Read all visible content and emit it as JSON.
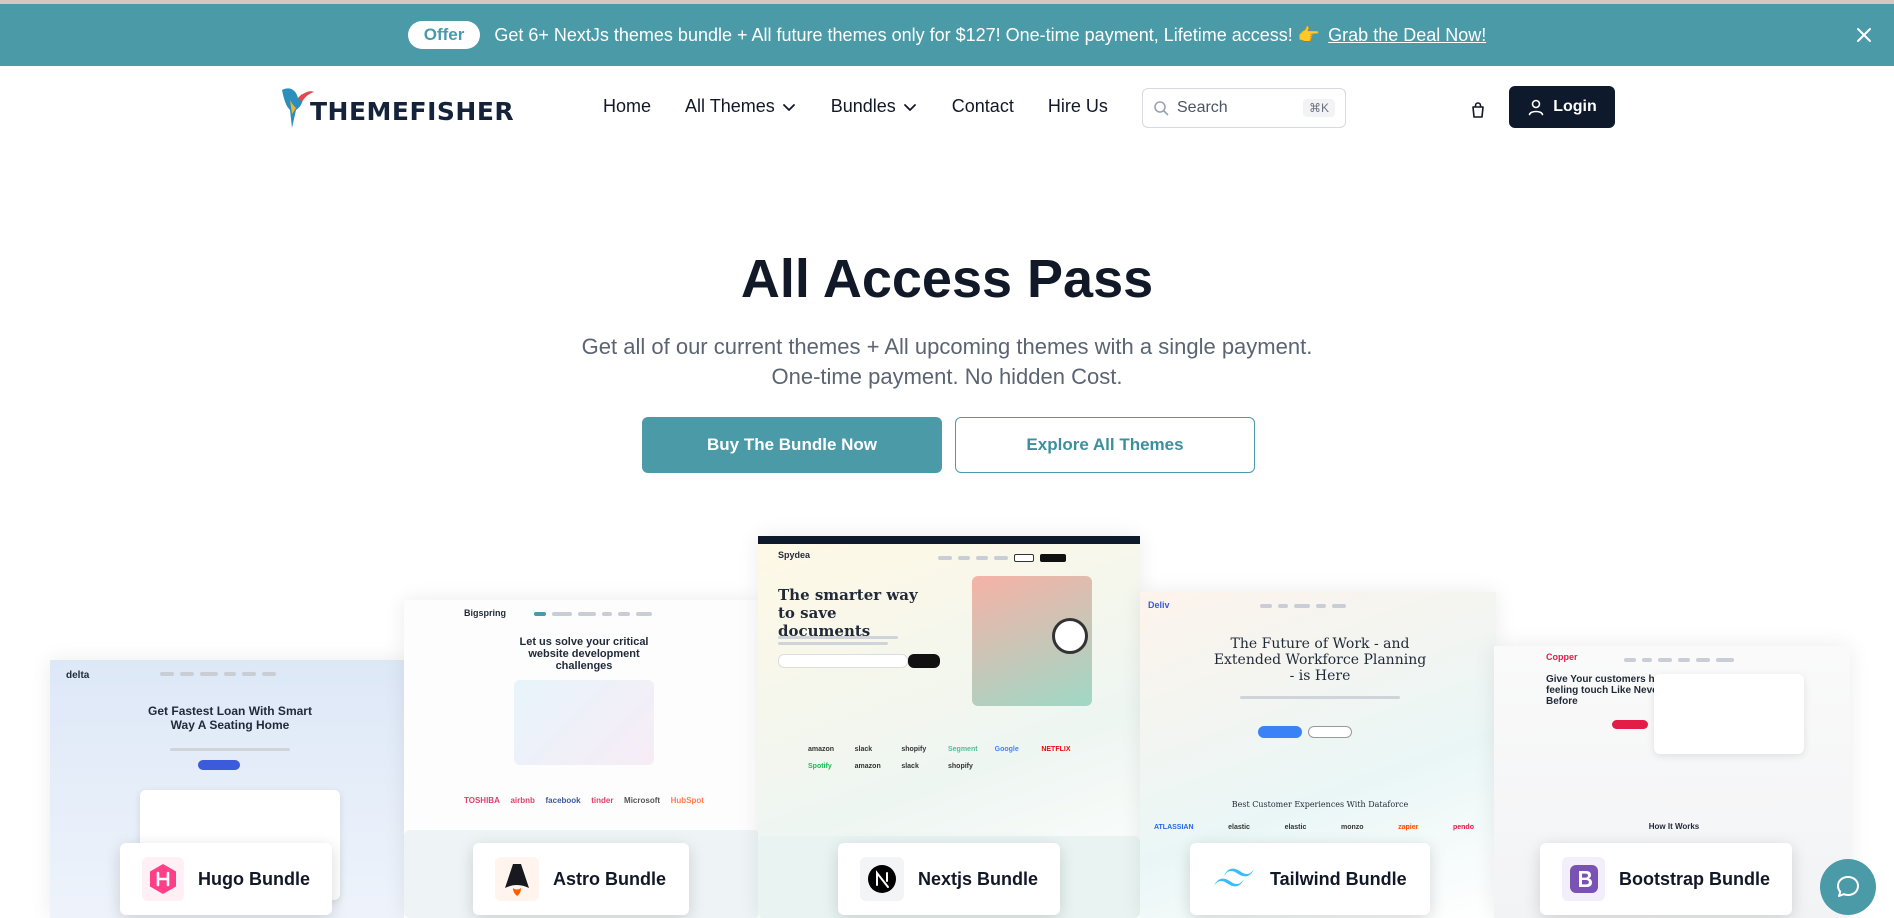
{
  "colors": {
    "accent": "#4a9aa8",
    "dark": "#0e1a2b"
  },
  "offer": {
    "pill": "Offer",
    "text": "Get 6+ NextJs themes bundle + All future themes only for $127! One-time payment, Lifetime access! 👉",
    "link": "Grab the Deal Now!"
  },
  "brand": {
    "name": "THEMEFISHER"
  },
  "nav": {
    "items": [
      {
        "label": "Home",
        "dropdown": false
      },
      {
        "label": "All Themes",
        "dropdown": true
      },
      {
        "label": "Bundles",
        "dropdown": true
      },
      {
        "label": "Contact",
        "dropdown": false
      },
      {
        "label": "Hire Us",
        "dropdown": false
      }
    ],
    "search_placeholder": "Search",
    "search_shortcut": "⌘K",
    "login": "Login"
  },
  "hero": {
    "title": "All Access Pass",
    "subtitle_line1": "Get all of our current themes + All upcoming themes with a single payment.",
    "subtitle_line2": "One-time payment. No hidden Cost.",
    "primary_button": "Buy The Bundle Now",
    "secondary_button": "Explore All Themes"
  },
  "previews": {
    "delta": {
      "brand": "delta",
      "heading": "Get Fastest Loan With Smart Way A Seating Home"
    },
    "bigspring": {
      "brand": "Bigspring",
      "heading": "Let us solve your critical website development challenges",
      "logos": [
        "TOSHIBA",
        "airbnb",
        "facebook",
        "tinder",
        "Microsoft",
        "HubSpot"
      ]
    },
    "spydea": {
      "brand": "Spydea",
      "heading": "The smarter way to save documents",
      "logos": [
        "amazon",
        "slack",
        "shopify",
        "Segment",
        "Google",
        "NETFLIX",
        "Spotify",
        "amazon",
        "slack",
        "shopify"
      ]
    },
    "delivery": {
      "brand": "Deliv",
      "heading": "The Future of Work - and Extended Workforce Planning - is Here",
      "subheading": "Best Customer Experiences With Dataforce",
      "logos": [
        "ATLASSIAN",
        "elastic",
        "elastic",
        "monzo",
        "zapier",
        "pendo"
      ]
    },
    "copper": {
      "brand": "Copper",
      "heading": "Give Your customers human feeling touch Like Never Before",
      "subheading": "How It Works"
    }
  },
  "bundles": [
    {
      "label": "Hugo Bundle",
      "icon": "hugo-icon",
      "color": "#ff4088"
    },
    {
      "label": "Astro Bundle",
      "icon": "astro-icon",
      "color": "#17191e"
    },
    {
      "label": "Nextjs Bundle",
      "icon": "nextjs-icon",
      "color": "#000000"
    },
    {
      "label": "Tailwind Bundle",
      "icon": "tailwind-icon",
      "color": "#38bdf8"
    },
    {
      "label": "Bootstrap Bundle",
      "icon": "bootstrap-icon",
      "color": "#7952b3"
    }
  ]
}
